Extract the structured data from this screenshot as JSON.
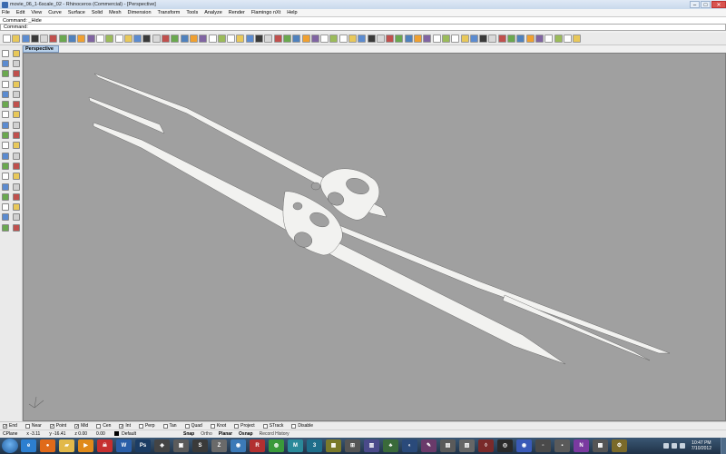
{
  "window": {
    "title": "movie_06_1-6scale_02 - Rhinoceros (Commercial) - [Perspective]",
    "controls": {
      "minimize": "–",
      "maximize": "□",
      "close": "✕"
    }
  },
  "menu": [
    "File",
    "Edit",
    "View",
    "Curve",
    "Surface",
    "Solid",
    "Mesh",
    "Dimension",
    "Transform",
    "Tools",
    "Analyze",
    "Render",
    "Flamingo nXt",
    "Help"
  ],
  "command_history": "Command: _Hide",
  "command_prompt": "Command:",
  "viewport": {
    "tab_label": "Perspective",
    "background": "#a0a0a0",
    "object_color": "#f2f2f0"
  },
  "osnaps": [
    {
      "label": "End",
      "checked": true
    },
    {
      "label": "Near",
      "checked": false
    },
    {
      "label": "Point",
      "checked": true
    },
    {
      "label": "Mid",
      "checked": true
    },
    {
      "label": "Cen",
      "checked": false
    },
    {
      "label": "Int",
      "checked": true
    },
    {
      "label": "Perp",
      "checked": false
    },
    {
      "label": "Tan",
      "checked": false
    },
    {
      "label": "Quad",
      "checked": false
    },
    {
      "label": "Knot",
      "checked": false
    },
    {
      "label": "Project",
      "checked": false
    },
    {
      "label": "STrack",
      "checked": false
    },
    {
      "label": "Disable",
      "checked": false
    }
  ],
  "status": {
    "cplane": "CPlane",
    "x": "x -3.11",
    "y": "y -16.41",
    "z": "z 0.00",
    "distance": "0.00",
    "layer": "Default",
    "panes": [
      "Snap",
      "Ortho",
      "Planar",
      "Osnap",
      "Record History"
    ]
  },
  "taskbar": {
    "apps": [
      {
        "icon": "ie-icon",
        "color": "#2d7fd0",
        "glyph": "e"
      },
      {
        "icon": "firefox-icon",
        "color": "#e06a1a",
        "glyph": "●"
      },
      {
        "icon": "folder-icon",
        "color": "#e2b94a",
        "glyph": "▰"
      },
      {
        "icon": "media-player-icon",
        "color": "#e08a1a",
        "glyph": "▶"
      },
      {
        "icon": "game-icon",
        "color": "#c62f2f",
        "glyph": "☠"
      },
      {
        "icon": "word-icon",
        "color": "#2a5ea8",
        "glyph": "W"
      },
      {
        "icon": "photoshop-icon",
        "color": "#1b3c64",
        "glyph": "Ps"
      },
      {
        "icon": "unity-icon",
        "color": "#444",
        "glyph": "◈"
      },
      {
        "icon": "app-icon",
        "color": "#5b5b5b",
        "glyph": "▣"
      },
      {
        "icon": "sketchbook-icon",
        "color": "#3a3a3a",
        "glyph": "S"
      },
      {
        "icon": "zbrush-icon",
        "color": "#6a6a6a",
        "glyph": "Z"
      },
      {
        "icon": "mudbox-icon",
        "color": "#3c7ab8",
        "glyph": "◉"
      },
      {
        "icon": "rhino-icon",
        "color": "#b23030",
        "glyph": "R"
      },
      {
        "icon": "chrome-icon",
        "color": "#3a9a3a",
        "glyph": "◍"
      },
      {
        "icon": "maya-icon",
        "color": "#2a8a9a",
        "glyph": "M"
      },
      {
        "icon": "max-icon",
        "color": "#1e6e8a",
        "glyph": "3"
      },
      {
        "icon": "app-icon-2",
        "color": "#7a7a2a",
        "glyph": "▦"
      },
      {
        "icon": "app-icon-3",
        "color": "#555",
        "glyph": "⊞"
      },
      {
        "icon": "app-icon-4",
        "color": "#4a4a8a",
        "glyph": "▥"
      },
      {
        "icon": "app-icon-5",
        "color": "#3a6a3a",
        "glyph": "♣"
      },
      {
        "icon": "app-icon-6",
        "color": "#2a4a7a",
        "glyph": "◐"
      },
      {
        "icon": "app-icon-7",
        "color": "#6a3a6a",
        "glyph": "✎"
      },
      {
        "icon": "app-icon-8",
        "color": "#5a5a5a",
        "glyph": "▤"
      },
      {
        "icon": "app-icon-9",
        "color": "#666",
        "glyph": "▧"
      },
      {
        "icon": "app-icon-10",
        "color": "#7a2a2a",
        "glyph": "◊"
      },
      {
        "icon": "app-icon-11",
        "color": "#2a2a2a",
        "glyph": "◎"
      },
      {
        "icon": "eye-app-icon",
        "color": "#3a5ab8",
        "glyph": "◉"
      },
      {
        "icon": "app-icon-12",
        "color": "#4a4a4a",
        "glyph": "▫"
      },
      {
        "icon": "app-icon-13",
        "color": "#5a5a5a",
        "glyph": "▪"
      },
      {
        "icon": "onenote-icon",
        "color": "#7a3aa0",
        "glyph": "N"
      },
      {
        "icon": "app-icon-14",
        "color": "#555",
        "glyph": "▩"
      },
      {
        "icon": "app-icon-15",
        "color": "#7a6a2a",
        "glyph": "⚙"
      }
    ],
    "time": "10:47 PM",
    "date": "7/10/2012"
  }
}
